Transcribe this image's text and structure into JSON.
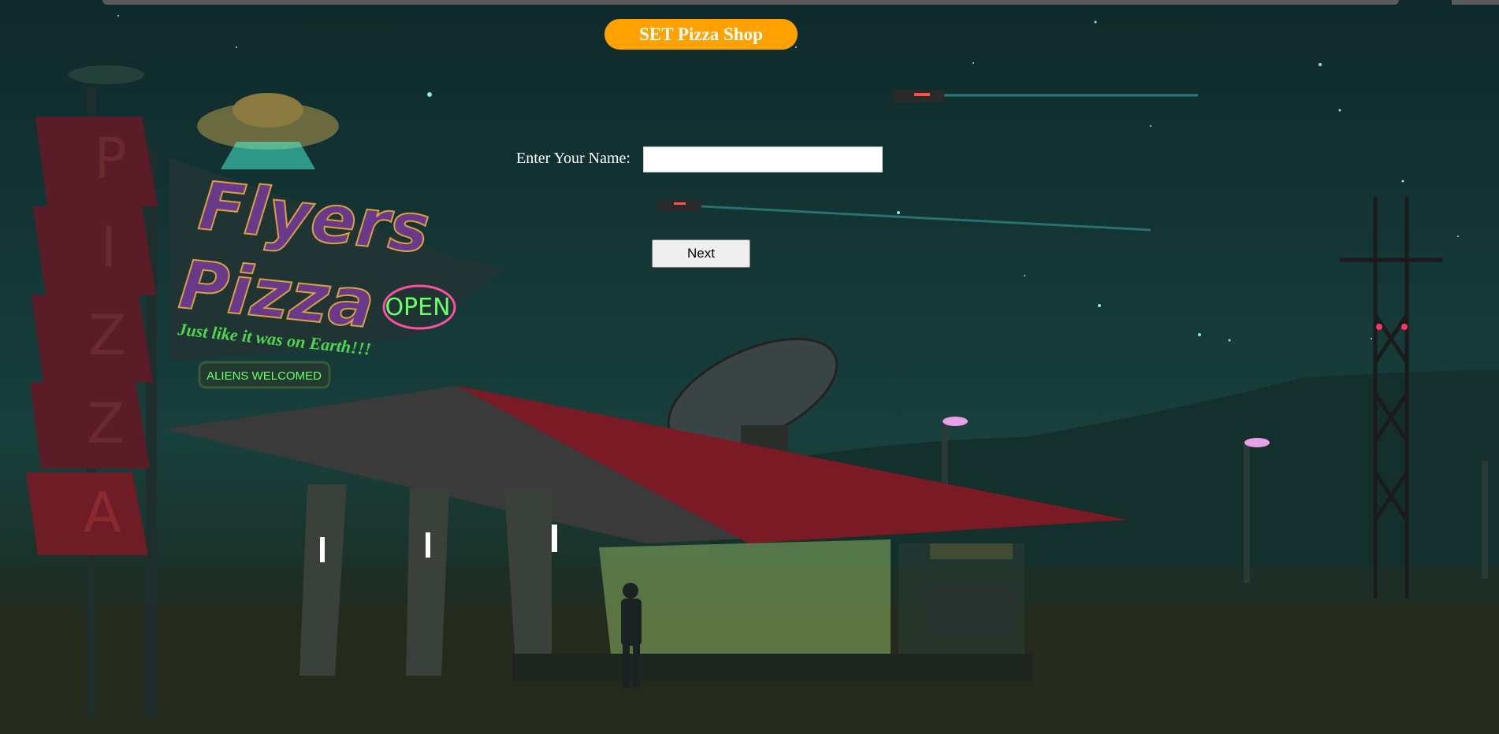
{
  "app": {
    "title": "SET Pizza Shop"
  },
  "form": {
    "name_label": "Enter Your Name:",
    "name_value": "",
    "name_placeholder": "",
    "next_label": "Next"
  },
  "background": {
    "sign_brand_line1": "Flyers",
    "sign_brand_line2": "Pizza",
    "sign_open": "OPEN",
    "sign_tagline": "Just like it was on Earth!!!",
    "sign_aliens": "ALIENS WELCOMED",
    "pylon_letters": [
      "P",
      "I",
      "Z",
      "Z",
      "A"
    ]
  },
  "colors": {
    "accent": "#ffa200",
    "sky": "#143635",
    "neon_green": "#6cff6c",
    "neon_pink": "#ff4fa0",
    "roof_red": "#8a1a24"
  }
}
